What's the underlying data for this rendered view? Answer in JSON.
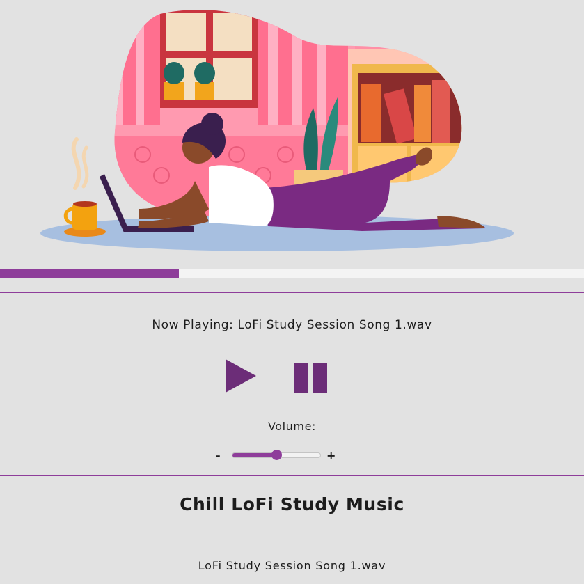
{
  "player": {
    "now_playing": "Now Playing: LoFi Study Session Song 1.wav",
    "progress_percent": 30.6,
    "volume_label": "Volume:",
    "volume_minus": "-",
    "volume_plus": "+",
    "volume_percent": 50
  },
  "playlist": {
    "title": "Chill LoFi Study Music",
    "songs": [
      "LoFi Study Session Song 1.wav"
    ]
  },
  "colors": {
    "accent": "#8e3d9a",
    "control": "#6c2d78",
    "background": "#e2e2e2"
  },
  "icons": {
    "play": "play-icon",
    "pause": "pause-icon"
  }
}
